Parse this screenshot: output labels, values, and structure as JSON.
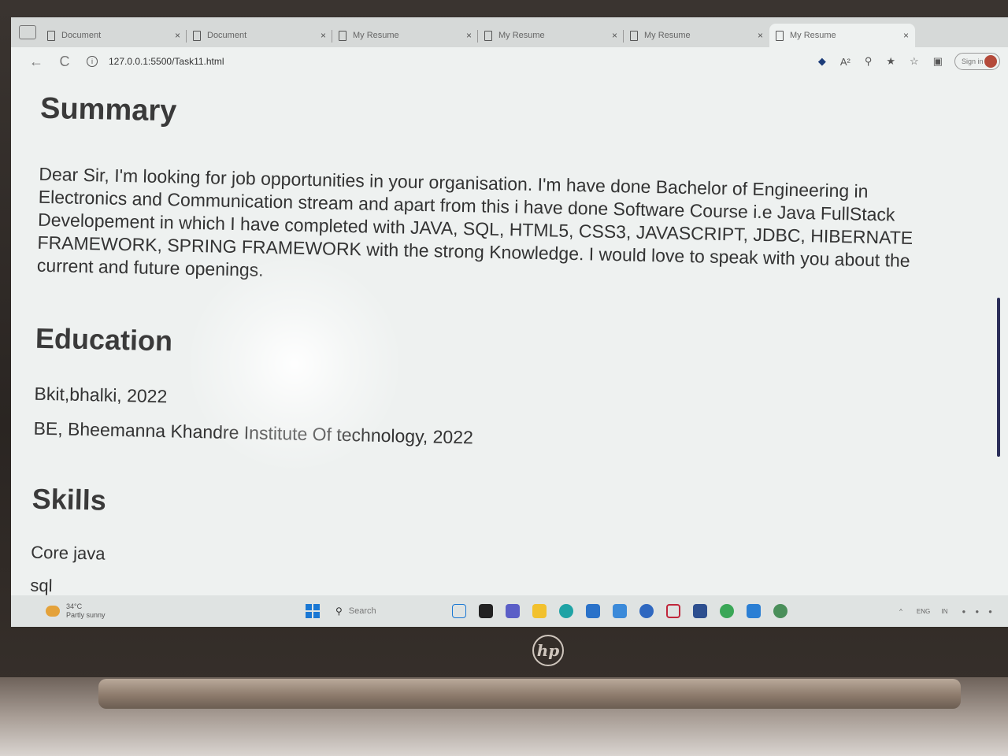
{
  "tabs": [
    {
      "label": "Document",
      "close": "×"
    },
    {
      "label": "Document",
      "close": "×"
    },
    {
      "label": "My Resume",
      "close": "×"
    },
    {
      "label": "My Resume",
      "close": "×"
    },
    {
      "label": "My Resume",
      "close": "×"
    },
    {
      "label": "My Resume",
      "close": "×"
    }
  ],
  "navbar": {
    "back": "←",
    "reload": "C",
    "url": "127.0.0.1:5500/Task11.html",
    "read_aloud": "A²",
    "signin": "Sign in"
  },
  "resume": {
    "summary_title": "Summary",
    "summary_text": "Dear Sir, I'm looking for job opportunities in your organisation. I'm have done Bachelor of Engineering in Electronics and Communication stream and apart from this i have done Software Course i.e Java FullStack Developement in which I have completed with JAVA, SQL, HTML5, CSS3, JAVASCRIPT, JDBC, HIBERNATE FRAMEWORK, SPRING FRAMEWORK with the strong Knowledge. I would love to speak with you about the current and future openings.",
    "education_title": "Education",
    "education": [
      "Bkit,bhalki, 2022",
      "BE, Bheemanna Khandre Institute Of technology, 2022"
    ],
    "skills_title": "Skills",
    "skills": [
      "Core java",
      "sql"
    ]
  },
  "taskbar": {
    "temperature": "34°C",
    "weather": "Partly sunny",
    "search_placeholder": "Search",
    "language": "ENG",
    "language_sub": "IN"
  },
  "hardware": {
    "logo": "hp"
  },
  "colors": {
    "screen_bg": "#eef1f0",
    "text": "#333333",
    "windows_blue": "#1a78d4",
    "scrollbar": "#2c2f5a"
  }
}
